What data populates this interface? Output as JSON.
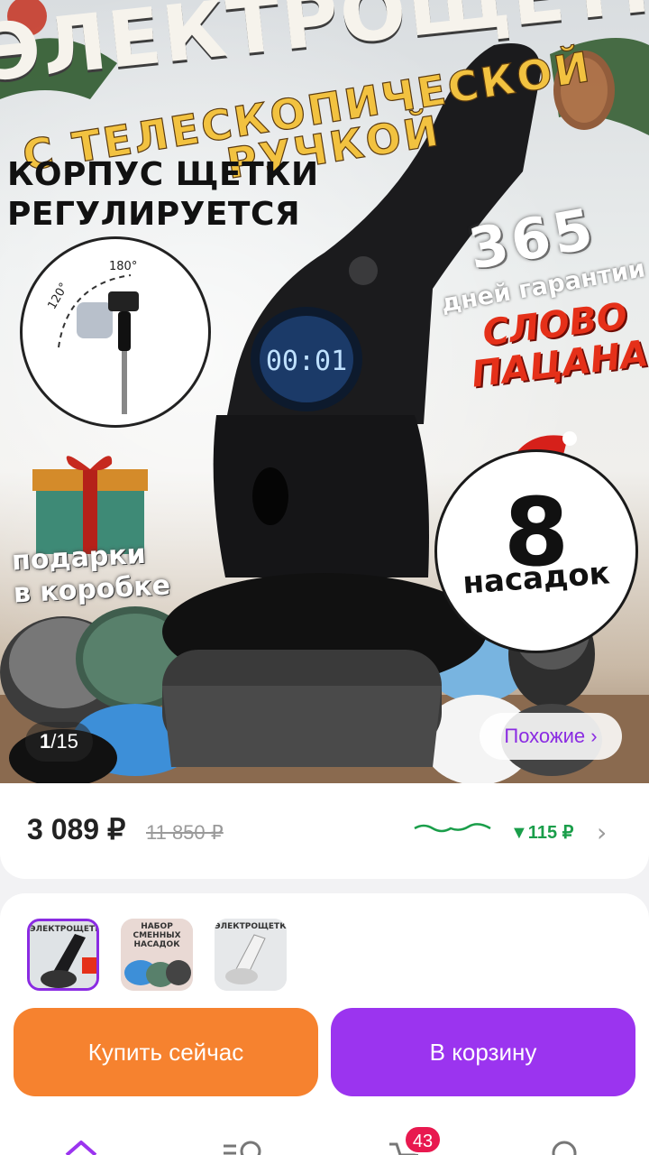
{
  "hero": {
    "banner_top": "ЭЛЕКТРОЩЕТКА",
    "banner_sub_line1": "С ТЕЛЕСКОПИЧЕСКОЙ",
    "banner_sub_line2": "РУЧКОЙ",
    "corpus_line1": "КОРПУС ЩЕТКИ",
    "corpus_line2": "РЕГУЛИРУЕТСЯ",
    "angle_120": "120°",
    "angle_180": "180°",
    "display_value": "00:01",
    "days_number": "365",
    "days_text": "дней гарантии",
    "slovo_line1": "СЛОВО",
    "slovo_line2": "ПАЦАНА",
    "gift_line1": "подарки",
    "gift_line2": "в коробке",
    "badge_number": "8",
    "badge_word": "насадок",
    "counter_current": "1",
    "counter_total": "/15",
    "similar_label": "Похожие ›"
  },
  "price": {
    "current": "3 089 ₽",
    "old": "11 850 ₽",
    "drop": "▼115 ₽",
    "chevron": "›"
  },
  "variants": [
    {
      "title": "ЭЛЕКТРОЩЕТКА",
      "selected": true
    },
    {
      "title": "НАБОР СМЕННЫХ НАСАДОК",
      "selected": false
    },
    {
      "title": "ЭЛЕКТРОЩЕТКА",
      "selected": false
    }
  ],
  "actions": {
    "buy_now": "Купить сейчас",
    "add_to_cart": "В корзину"
  },
  "nav": {
    "cart_count": "43",
    "icons": [
      "home-icon",
      "catalog-icon",
      "cart-icon",
      "profile-icon"
    ]
  },
  "colors": {
    "accent_purple": "#9b34ef",
    "accent_orange": "#f6822f",
    "price_drop_green": "#1a9e4a",
    "badge_red": "#e8194f"
  }
}
